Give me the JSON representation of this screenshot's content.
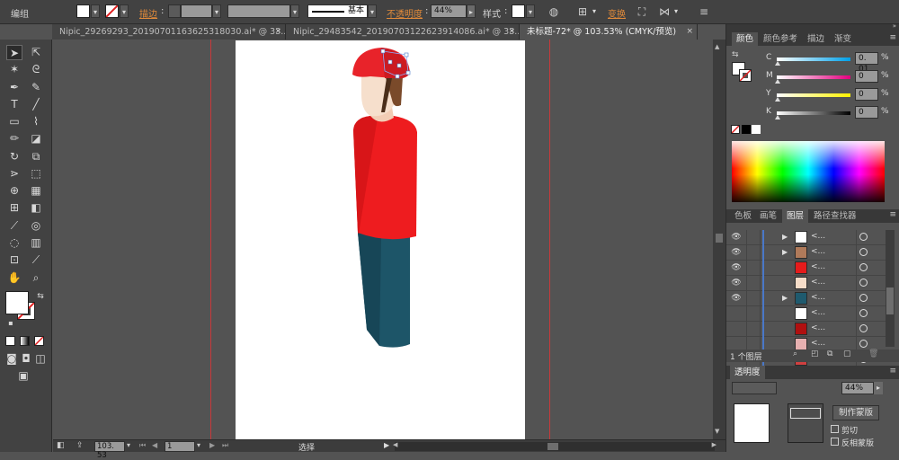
{
  "control_bar": {
    "group_label": "编组",
    "stroke_label": "描边",
    "stroke_profile": "基本",
    "opacity_label": "不透明度",
    "opacity_value": "44%",
    "style_label": "样式",
    "transform_label": "变换"
  },
  "doc_tabs": [
    {
      "title": "Nipic_29269293_20190701163625318030.ai* @ 33...",
      "close": "×"
    },
    {
      "title": "Nipic_29483542_20190703122623914086.ai* @ 33...",
      "close": "×"
    },
    {
      "title": "未标题-72* @ 103.53% (CMYK/预览)",
      "close": "×"
    }
  ],
  "status_bar": {
    "zoom": "103. 53",
    "page": "1",
    "tool_name": "选择"
  },
  "color_panel": {
    "tabs": [
      "颜色",
      "颜色参考",
      "描边",
      "渐变"
    ],
    "channels": [
      {
        "label": "C",
        "value": "0. 01",
        "gradient": [
          "#ffffff",
          "#00a0e8"
        ]
      },
      {
        "label": "M",
        "value": "0",
        "gradient": [
          "#ffffff",
          "#e4007f"
        ]
      },
      {
        "label": "Y",
        "value": "0",
        "gradient": [
          "#ffffff",
          "#fff100"
        ]
      },
      {
        "label": "K",
        "value": "0",
        "gradient": [
          "#ffffff",
          "#000000"
        ]
      }
    ],
    "percent": "%"
  },
  "layers_panel": {
    "tabs": [
      "色板",
      "画笔",
      "图层",
      "路径查找器"
    ],
    "rows": [
      {
        "name": "<...",
        "thumb": "#ffffff",
        "visible": true,
        "has_children": true
      },
      {
        "name": "<...",
        "thumb": "#b07a5a",
        "visible": true,
        "has_children": true
      },
      {
        "name": "<...",
        "thumb": "#e51b1b",
        "visible": true,
        "has_children": false
      },
      {
        "name": "<...",
        "thumb": "#f5dcc8",
        "visible": true,
        "has_children": false
      },
      {
        "name": "<...",
        "thumb": "#1f5a6e",
        "visible": true,
        "has_children": true
      },
      {
        "name": "<...",
        "thumb": "#ffffff",
        "visible": false,
        "has_children": false
      },
      {
        "name": "<...",
        "thumb": "#b01010",
        "visible": false,
        "has_children": false
      },
      {
        "name": "<...",
        "thumb": "#e6b0b0",
        "visible": false,
        "has_children": false
      },
      {
        "name": "<...",
        "thumb": "#d04040",
        "visible": false,
        "has_children": true
      }
    ],
    "footer_count": "1 个图层"
  },
  "transparency_panel": {
    "title": "透明度",
    "opacity_value": "44%",
    "make_mask_button": "制作蒙版",
    "clip_label": "剪切",
    "invert_label": "反相蒙版"
  },
  "colors": {
    "helmet": "#e8232a",
    "shirt": "#ee1c1f",
    "pants": "#1d5568",
    "skin": "#f6dfcc",
    "hair": "#7a4a2a",
    "guide": "#c8393a"
  }
}
